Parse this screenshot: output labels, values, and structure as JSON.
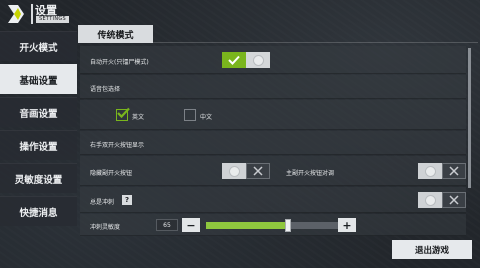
{
  "header": {
    "title": "设置",
    "subtitle": "SETTINGS"
  },
  "sidebar": {
    "items": [
      {
        "label": "开火模式",
        "active": false
      },
      {
        "label": "基础设置",
        "active": true
      },
      {
        "label": "音画设置",
        "active": false
      },
      {
        "label": "操作设置",
        "active": false
      },
      {
        "label": "灵敏度设置",
        "active": false
      },
      {
        "label": "快捷消息",
        "active": false
      }
    ]
  },
  "main": {
    "tab": "传统模式",
    "auto_fire": {
      "label": "自动开火(只镭尸模式)",
      "on": true
    },
    "voice_pack": {
      "label": "语音包选择",
      "options": [
        {
          "label": "英文",
          "checked": true
        },
        {
          "label": "中文",
          "checked": false
        }
      ]
    },
    "right_fire_section": "右手双开火按钮显示",
    "hide_sub_fire": {
      "label": "隐藏副开火按钮",
      "on": false
    },
    "main_fire_align": {
      "label": "主副开火按钮对调",
      "on": false
    },
    "always_sprint": {
      "label": "总是冲刺",
      "help": "?",
      "on": false
    },
    "sprint_sensitivity": {
      "label": "冲刺灵敏度",
      "value": "65",
      "minus": "−",
      "plus": "+",
      "percent": 60
    }
  },
  "footer": {
    "exit_label": "退出游戏"
  },
  "colors": {
    "accent": "#7ab51d",
    "active_tab": "#e6e9ec"
  }
}
